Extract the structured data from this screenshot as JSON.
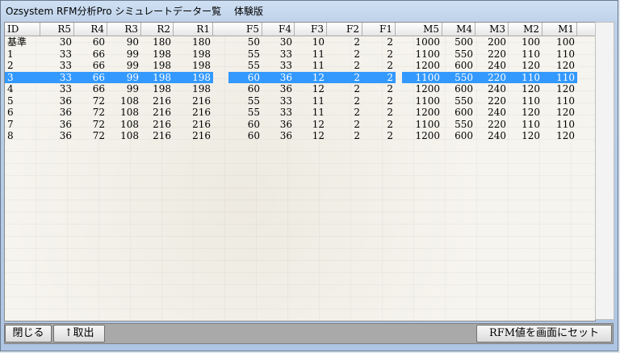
{
  "window": {
    "title": "Ozsystem RFM分析Pro シミュレートデーター覧　 体験版"
  },
  "table": {
    "headers": [
      "ID",
      "R5",
      "R4",
      "R3",
      "R2",
      "R1",
      "F5",
      "F4",
      "F3",
      "F2",
      "F1",
      "M5",
      "M4",
      "M3",
      "M2",
      "M1"
    ],
    "rows": [
      [
        "基準",
        "30",
        "60",
        "90",
        "180",
        "180",
        "50",
        "30",
        "10",
        "2",
        "2",
        "1000",
        "500",
        "200",
        "100",
        "100"
      ],
      [
        "1",
        "33",
        "66",
        "99",
        "198",
        "198",
        "55",
        "33",
        "11",
        "2",
        "2",
        "1100",
        "550",
        "220",
        "110",
        "110"
      ],
      [
        "2",
        "33",
        "66",
        "99",
        "198",
        "198",
        "55",
        "33",
        "11",
        "2",
        "2",
        "1200",
        "600",
        "240",
        "120",
        "120"
      ],
      [
        "3",
        "33",
        "66",
        "99",
        "198",
        "198",
        "60",
        "36",
        "12",
        "2",
        "2",
        "1100",
        "550",
        "220",
        "110",
        "110"
      ],
      [
        "4",
        "33",
        "66",
        "99",
        "198",
        "198",
        "60",
        "36",
        "12",
        "2",
        "2",
        "1200",
        "600",
        "240",
        "120",
        "120"
      ],
      [
        "5",
        "36",
        "72",
        "108",
        "216",
        "216",
        "55",
        "33",
        "11",
        "2",
        "2",
        "1100",
        "550",
        "220",
        "110",
        "110"
      ],
      [
        "6",
        "36",
        "72",
        "108",
        "216",
        "216",
        "55",
        "33",
        "11",
        "2",
        "2",
        "1200",
        "600",
        "240",
        "120",
        "120"
      ],
      [
        "7",
        "36",
        "72",
        "108",
        "216",
        "216",
        "60",
        "36",
        "12",
        "2",
        "2",
        "1100",
        "550",
        "220",
        "110",
        "110"
      ],
      [
        "8",
        "36",
        "72",
        "108",
        "216",
        "216",
        "60",
        "36",
        "12",
        "2",
        "2",
        "1200",
        "600",
        "240",
        "120",
        "120"
      ]
    ],
    "selected_row": 3
  },
  "footer": {
    "close_label": "閉じる",
    "extract_label": "↑取出",
    "set_label": "RFM値を画面にセット"
  },
  "colors": {
    "selection": "#3399ff",
    "footer_bg": "#a9a9a9"
  }
}
